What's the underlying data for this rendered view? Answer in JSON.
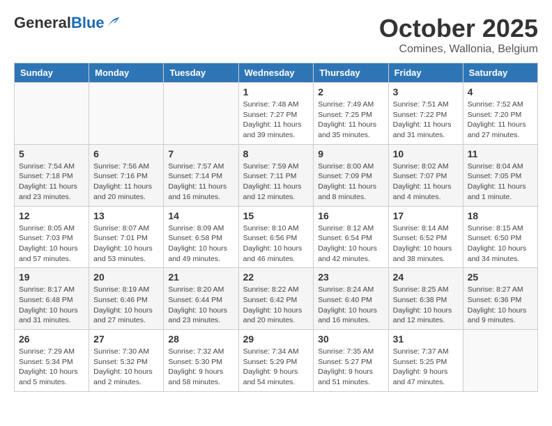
{
  "header": {
    "logo_general": "General",
    "logo_blue": "Blue",
    "title": "October 2025",
    "subtitle": "Comines, Wallonia, Belgium"
  },
  "days_of_week": [
    "Sunday",
    "Monday",
    "Tuesday",
    "Wednesday",
    "Thursday",
    "Friday",
    "Saturday"
  ],
  "weeks": [
    [
      {
        "day": "",
        "info": ""
      },
      {
        "day": "",
        "info": ""
      },
      {
        "day": "",
        "info": ""
      },
      {
        "day": "1",
        "info": "Sunrise: 7:48 AM\nSunset: 7:27 PM\nDaylight: 11 hours\nand 39 minutes."
      },
      {
        "day": "2",
        "info": "Sunrise: 7:49 AM\nSunset: 7:25 PM\nDaylight: 11 hours\nand 35 minutes."
      },
      {
        "day": "3",
        "info": "Sunrise: 7:51 AM\nSunset: 7:22 PM\nDaylight: 11 hours\nand 31 minutes."
      },
      {
        "day": "4",
        "info": "Sunrise: 7:52 AM\nSunset: 7:20 PM\nDaylight: 11 hours\nand 27 minutes."
      }
    ],
    [
      {
        "day": "5",
        "info": "Sunrise: 7:54 AM\nSunset: 7:18 PM\nDaylight: 11 hours\nand 23 minutes."
      },
      {
        "day": "6",
        "info": "Sunrise: 7:56 AM\nSunset: 7:16 PM\nDaylight: 11 hours\nand 20 minutes."
      },
      {
        "day": "7",
        "info": "Sunrise: 7:57 AM\nSunset: 7:14 PM\nDaylight: 11 hours\nand 16 minutes."
      },
      {
        "day": "8",
        "info": "Sunrise: 7:59 AM\nSunset: 7:11 PM\nDaylight: 11 hours\nand 12 minutes."
      },
      {
        "day": "9",
        "info": "Sunrise: 8:00 AM\nSunset: 7:09 PM\nDaylight: 11 hours\nand 8 minutes."
      },
      {
        "day": "10",
        "info": "Sunrise: 8:02 AM\nSunset: 7:07 PM\nDaylight: 11 hours\nand 4 minutes."
      },
      {
        "day": "11",
        "info": "Sunrise: 8:04 AM\nSunset: 7:05 PM\nDaylight: 11 hours\nand 1 minute."
      }
    ],
    [
      {
        "day": "12",
        "info": "Sunrise: 8:05 AM\nSunset: 7:03 PM\nDaylight: 10 hours\nand 57 minutes."
      },
      {
        "day": "13",
        "info": "Sunrise: 8:07 AM\nSunset: 7:01 PM\nDaylight: 10 hours\nand 53 minutes."
      },
      {
        "day": "14",
        "info": "Sunrise: 8:09 AM\nSunset: 6:58 PM\nDaylight: 10 hours\nand 49 minutes."
      },
      {
        "day": "15",
        "info": "Sunrise: 8:10 AM\nSunset: 6:56 PM\nDaylight: 10 hours\nand 46 minutes."
      },
      {
        "day": "16",
        "info": "Sunrise: 8:12 AM\nSunset: 6:54 PM\nDaylight: 10 hours\nand 42 minutes."
      },
      {
        "day": "17",
        "info": "Sunrise: 8:14 AM\nSunset: 6:52 PM\nDaylight: 10 hours\nand 38 minutes."
      },
      {
        "day": "18",
        "info": "Sunrise: 8:15 AM\nSunset: 6:50 PM\nDaylight: 10 hours\nand 34 minutes."
      }
    ],
    [
      {
        "day": "19",
        "info": "Sunrise: 8:17 AM\nSunset: 6:48 PM\nDaylight: 10 hours\nand 31 minutes."
      },
      {
        "day": "20",
        "info": "Sunrise: 8:19 AM\nSunset: 6:46 PM\nDaylight: 10 hours\nand 27 minutes."
      },
      {
        "day": "21",
        "info": "Sunrise: 8:20 AM\nSunset: 6:44 PM\nDaylight: 10 hours\nand 23 minutes."
      },
      {
        "day": "22",
        "info": "Sunrise: 8:22 AM\nSunset: 6:42 PM\nDaylight: 10 hours\nand 20 minutes."
      },
      {
        "day": "23",
        "info": "Sunrise: 8:24 AM\nSunset: 6:40 PM\nDaylight: 10 hours\nand 16 minutes."
      },
      {
        "day": "24",
        "info": "Sunrise: 8:25 AM\nSunset: 6:38 PM\nDaylight: 10 hours\nand 12 minutes."
      },
      {
        "day": "25",
        "info": "Sunrise: 8:27 AM\nSunset: 6:36 PM\nDaylight: 10 hours\nand 9 minutes."
      }
    ],
    [
      {
        "day": "26",
        "info": "Sunrise: 7:29 AM\nSunset: 5:34 PM\nDaylight: 10 hours\nand 5 minutes."
      },
      {
        "day": "27",
        "info": "Sunrise: 7:30 AM\nSunset: 5:32 PM\nDaylight: 10 hours\nand 2 minutes."
      },
      {
        "day": "28",
        "info": "Sunrise: 7:32 AM\nSunset: 5:30 PM\nDaylight: 9 hours\nand 58 minutes."
      },
      {
        "day": "29",
        "info": "Sunrise: 7:34 AM\nSunset: 5:29 PM\nDaylight: 9 hours\nand 54 minutes."
      },
      {
        "day": "30",
        "info": "Sunrise: 7:35 AM\nSunset: 5:27 PM\nDaylight: 9 hours\nand 51 minutes."
      },
      {
        "day": "31",
        "info": "Sunrise: 7:37 AM\nSunset: 5:25 PM\nDaylight: 9 hours\nand 47 minutes."
      },
      {
        "day": "",
        "info": ""
      }
    ]
  ]
}
